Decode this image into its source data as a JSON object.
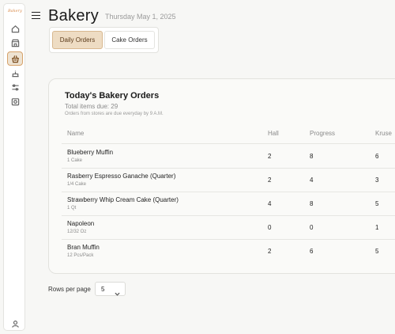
{
  "app": {
    "logo_text": "Bakery"
  },
  "header": {
    "title": "Bakery",
    "date": "Thursday May 1, 2025"
  },
  "tabs": [
    {
      "label": "Daily Orders",
      "active": true
    },
    {
      "label": "Cake Orders",
      "active": false
    }
  ],
  "sidebar": {
    "icons": [
      "home-icon",
      "store-icon",
      "bakery-basket-icon",
      "cake-icon",
      "sliders-icon",
      "camera-icon",
      "user-icon"
    ],
    "active_icon": "bakery-basket-icon"
  },
  "card": {
    "title": "Today's Bakery Orders",
    "total": "Total items due: 29",
    "note": "Orders from stores are due everyday by 9 A.M."
  },
  "table": {
    "headers": [
      "Name",
      "Hall",
      "Progress",
      "Kruse"
    ],
    "rows": [
      {
        "name": "Blueberry Muffin",
        "unit": "1 Cake",
        "hall": "2",
        "progress": "8",
        "kruse": "6"
      },
      {
        "name": "Rasberry Espresso Ganache (Quarter)",
        "unit": "1/4 Cake",
        "hall": "2",
        "progress": "4",
        "kruse": "3"
      },
      {
        "name": "Strawberry Whip Cream Cake (Quarter)",
        "unit": "1 Qt",
        "hall": "4",
        "progress": "8",
        "kruse": "5"
      },
      {
        "name": "Napoleon",
        "unit": "12/32 Oz",
        "hall": "0",
        "progress": "0",
        "kruse": "1"
      },
      {
        "name": "Bran Muffin",
        "unit": "12 Pcs/Pack",
        "hall": "2",
        "progress": "6",
        "kruse": "5"
      }
    ]
  },
  "pagination": {
    "label": "Rows per page",
    "value": "5"
  },
  "colors": {
    "accent": "#eedcc3",
    "accent_border": "#d8b890",
    "background": "#f7f7f5"
  }
}
